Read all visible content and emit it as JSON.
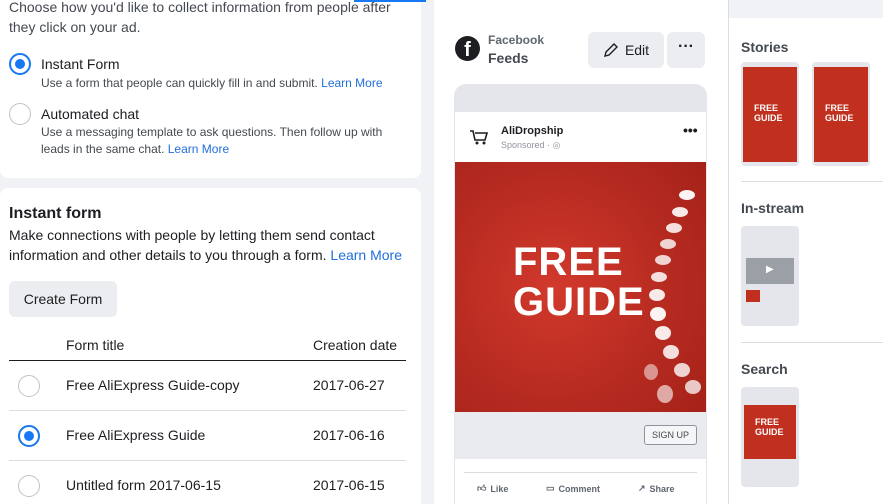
{
  "collect": {
    "intro": "Choose how you'd like to collect information from people after they click on your ad.",
    "options": [
      {
        "title": "Instant Form",
        "desc": "Use a form that people can quickly fill in and submit.",
        "link": "Learn More",
        "selected": true
      },
      {
        "title": "Automated chat",
        "desc": "Use a messaging template to ask questions. Then follow up with leads in the same chat.",
        "link": "Learn More",
        "selected": false
      }
    ]
  },
  "instant_form": {
    "title": "Instant form",
    "desc": "Make connections with people by letting them send contact information and other details to you through a form.",
    "link": "Learn More",
    "create_button": "Create Form",
    "columns": [
      "Form title",
      "Creation date"
    ],
    "rows": [
      {
        "title": "Free AliExpress Guide-copy",
        "date": "2017-06-27",
        "selected": false
      },
      {
        "title": "Free AliExpress Guide",
        "date": "2017-06-16",
        "selected": true
      },
      {
        "title": "Untitled form 2017-06-15",
        "date": "2017-06-15",
        "selected": false
      }
    ]
  },
  "preview": {
    "platform": "Facebook",
    "placement": "Feeds",
    "edit_label": "Edit",
    "more_label": "···",
    "post": {
      "page_name": "AliDropship",
      "sponsored": "Sponsored ·",
      "more": "•••",
      "creative_text_line1": "FREE",
      "creative_text_line2": "GUIDE",
      "cta": "SIGN UP",
      "actions": [
        "Like",
        "Comment",
        "Share"
      ]
    }
  },
  "placements": {
    "stories_label": "Stories",
    "instream_label": "In-stream",
    "search_label": "Search",
    "mini_text": "FREE GUIDE"
  },
  "colors": {
    "accent": "#1877f2",
    "creative": "#c1301f"
  }
}
